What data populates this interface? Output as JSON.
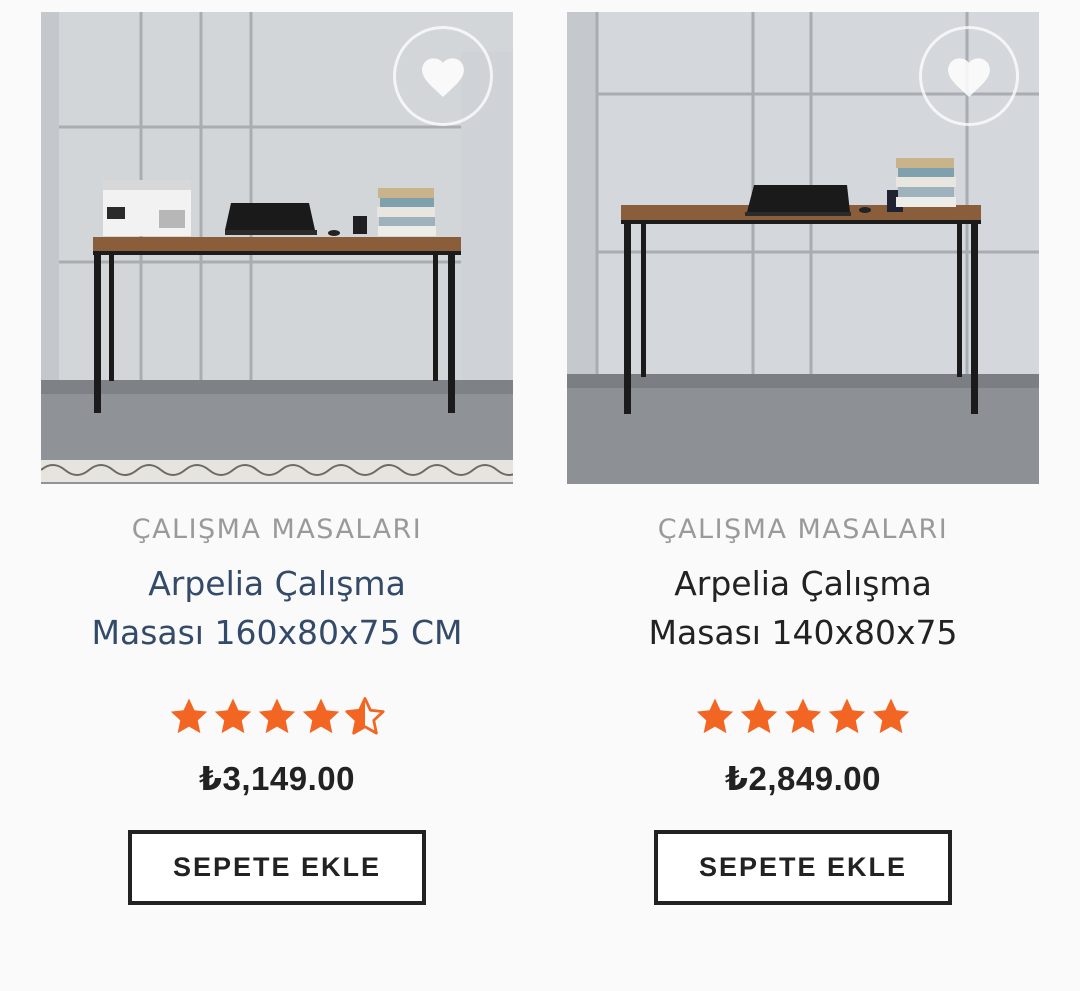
{
  "products": [
    {
      "category": "ÇALIŞMA MASALARI",
      "title_line1": "Arpelia Çalışma",
      "title_line2": "Masası 160x80x75 CM",
      "rating": 4.5,
      "price": "₺3,149.00",
      "button_label": "SEPETE EKLE"
    },
    {
      "category": "ÇALIŞMA MASALARI",
      "title_line1": "Arpelia Çalışma",
      "title_line2": "Masası 140x80x75",
      "rating": 5,
      "price": "₺2,849.00",
      "button_label": "SEPETE EKLE"
    }
  ],
  "colors": {
    "star": "#f26522",
    "title_link": "#334b69",
    "title": "#222222",
    "category": "#9a9a9a"
  },
  "icons": {
    "wishlist": "heart-icon",
    "rating": "star-icon"
  }
}
